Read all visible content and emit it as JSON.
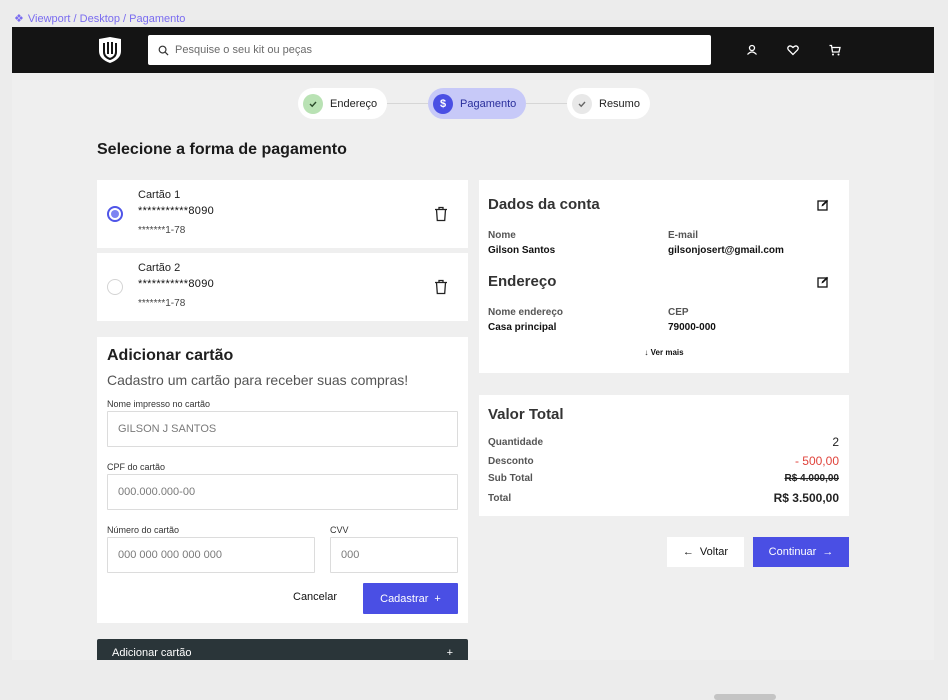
{
  "breadcrumb": {
    "icon": "component-icon",
    "path": "Viewport / Desktop  / Pagamento"
  },
  "header": {
    "search_placeholder": "Pesquise o seu kit ou peças"
  },
  "stepper": [
    {
      "label": "Endereço",
      "state": "done",
      "icon": "check-icon"
    },
    {
      "label": "Pagamento",
      "state": "active",
      "icon": "dollar-icon"
    },
    {
      "label": "Resumo",
      "state": "pending",
      "icon": "check-icon"
    }
  ],
  "page_title": "Selecione a forma de pagamento",
  "cards": [
    {
      "name": "Cartão 1",
      "number": "***********8090",
      "cpf": "*******1-78",
      "selected": true
    },
    {
      "name": "Cartão 2",
      "number": "***********8090",
      "cpf": "*******1-78",
      "selected": false
    }
  ],
  "add_card": {
    "title": "Adicionar cartão",
    "subtitle": "Cadastro um cartão para receber suas compras!",
    "name_label": "Nome impresso no cartão",
    "name_value": "GILSON J SANTOS",
    "cpf_label": "CPF do cartão",
    "cpf_placeholder": "000.000.000-00",
    "number_label": "Número do cartão",
    "number_placeholder": "000 000 000 000 000",
    "cvv_label": "CVV",
    "cvv_placeholder": "000",
    "cancel_label": "Cancelar",
    "submit_label": "Cadastrar",
    "submit_icon": "+"
  },
  "collapsed_bar": {
    "label": "Adicionar cartão",
    "icon": "+"
  },
  "account": {
    "title": "Dados da conta",
    "name_key": "Nome",
    "name_value": "Gilson Santos",
    "email_key": "E-mail",
    "email_value": "gilsonjosert@gmail.com",
    "address_title": "Endereço",
    "addr_name_key": "Nome endereço",
    "addr_name_value": "Casa principal",
    "cep_key": "CEP",
    "cep_value": "79000-000",
    "see_more": "Ver mais"
  },
  "totals": {
    "title": "Valor Total",
    "qty_key": "Quantidade",
    "qty_value": "2",
    "discount_key": "Desconto",
    "discount_value": "- 500,00",
    "subtotal_key": "Sub Total",
    "subtotal_value": "R$ 4.000,00",
    "total_key": "Total",
    "total_value": "R$ 3.500,00"
  },
  "actions": {
    "back_label": "Voltar",
    "continue_label": "Continuar"
  },
  "colors": {
    "accent": "#4a4fe4",
    "discount": "#e0433b",
    "dark_bar": "#2a3539",
    "topbar": "#141414",
    "step_active_bg": "#c7c9f8",
    "step_done": "#b9e2b4"
  }
}
